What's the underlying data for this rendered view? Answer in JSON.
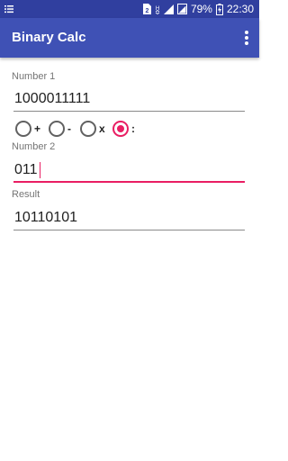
{
  "status_bar": {
    "battery_percent": "79%",
    "time": "22:30",
    "icons": [
      "notification-list-icon",
      "sim-icon",
      "data-icon",
      "signal-icon",
      "signal-alt-icon",
      "battery-icon"
    ]
  },
  "app_bar": {
    "title": "Binary Calc",
    "menu_icon": "more-vertical-icon"
  },
  "number1": {
    "label": "Number 1",
    "value": "1000011111"
  },
  "operations": [
    {
      "label": "+",
      "checked": false
    },
    {
      "label": "-",
      "checked": false
    },
    {
      "label": "x",
      "checked": false
    },
    {
      "label": ":",
      "checked": true
    }
  ],
  "number2": {
    "label": "Number 2",
    "value": "011"
  },
  "result": {
    "label": "Result",
    "value": "10110101"
  },
  "colors": {
    "primary": "#3f51b5",
    "primary_dark": "#303f9f",
    "accent": "#e91e63"
  }
}
